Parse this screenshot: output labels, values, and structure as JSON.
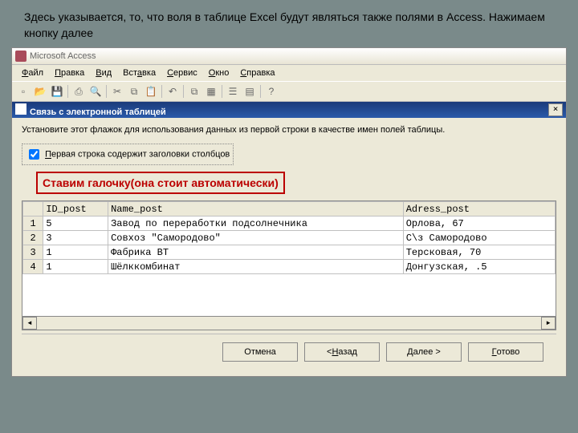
{
  "caption": "Здесь указывается, то, что воля в таблице Excel будут являться также полями в Access. Нажимаем кнопку далее",
  "app_title": "Microsoft Access",
  "menu": {
    "file": "Файл",
    "edit": "Правка",
    "view": "Вид",
    "insert": "Вставка",
    "service": "Сервис",
    "window": "Окно",
    "help": "Справка"
  },
  "wizard_title": "Связь с электронной таблицей",
  "instruction": "Установите этот флажок для использования данных из первой строки в качестве имен полей таблицы.",
  "checkbox_label": "Первая строка содержит заголовки столбцов",
  "annotation": "Ставим галочку(она стоит автоматически)",
  "grid": {
    "headers": {
      "id": "ID_post",
      "name": "Name_post",
      "adr": "Adress_post"
    },
    "rows": [
      {
        "n": "1",
        "id": "5",
        "name": "Завод по переработки подсолнечника",
        "adr": "Орлова, 67"
      },
      {
        "n": "2",
        "id": "3",
        "name": "Совхоз \"Самородово\"",
        "adr": "С\\з Самородово"
      },
      {
        "n": "3",
        "id": "1",
        "name": "Фабрика ВТ",
        "adr": "Терсковая, 70"
      },
      {
        "n": "4",
        "id": "1",
        "name": "Шёлккомбинат",
        "adr": "Донгузская, .5"
      }
    ]
  },
  "buttons": {
    "cancel": "Отмена",
    "back": "< Назад",
    "next": "Далее >",
    "finish": "Готово"
  }
}
